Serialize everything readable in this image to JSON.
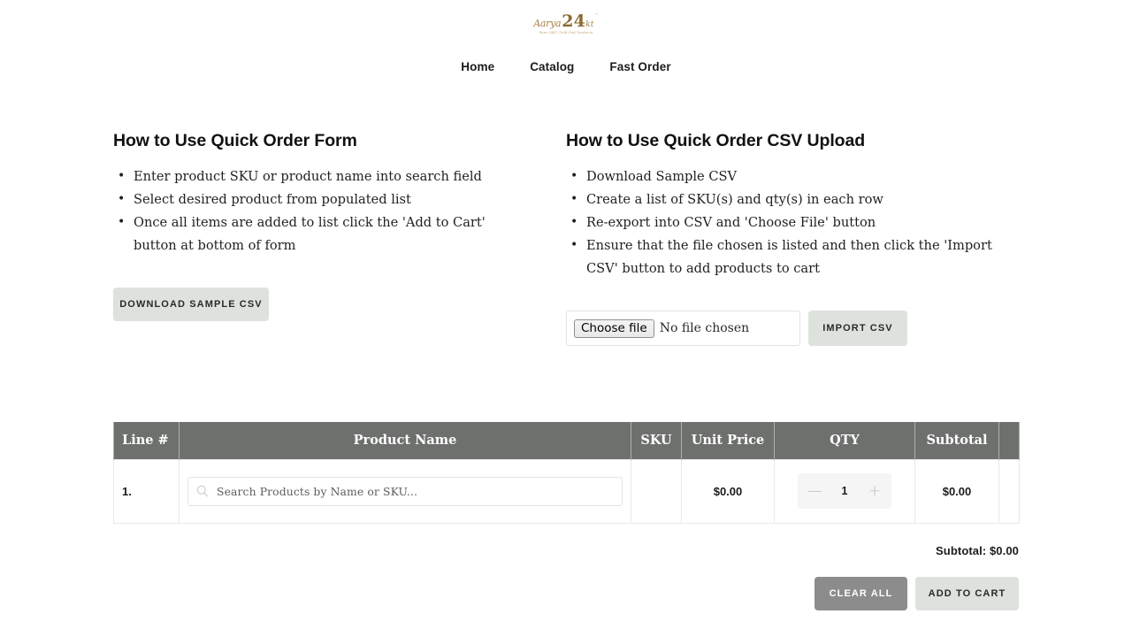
{
  "header": {
    "logo": {
      "word1": "Aarya",
      "word2": "24",
      "word3": "kt",
      "trademark": "™",
      "tagline": "Pure 24KT Gold Foil Products"
    },
    "nav": [
      {
        "label": "Home",
        "name": "nav-home"
      },
      {
        "label": "Catalog",
        "name": "nav-catalog"
      },
      {
        "label": "Fast Order",
        "name": "nav-fast-order"
      }
    ]
  },
  "left_panel": {
    "title": "How to Use Quick Order Form",
    "bullets": [
      "Enter product SKU or product name into search field",
      "Select desired product from populated list",
      "Once all items are added to list click the 'Add to Cart' button at bottom of form"
    ],
    "download_button": "DOWNLOAD SAMPLE CSV"
  },
  "right_panel": {
    "title": "How to Use Quick Order CSV Upload",
    "bullets": [
      "Download Sample CSV",
      "Create a list of SKU(s) and qty(s) in each row",
      "Re-export into CSV and 'Choose File' button",
      "Ensure that the file chosen is listed and then click the 'Import CSV' button to add products to cart"
    ],
    "file_input": {
      "button_label": "Choose file",
      "status": "No file chosen"
    },
    "import_button": "IMPORT CSV"
  },
  "table": {
    "headers": {
      "line": "Line #",
      "product": "Product Name",
      "sku": "SKU",
      "price": "Unit Price",
      "qty": "QTY",
      "subtotal": "Subtotal",
      "remove": ""
    },
    "rows": [
      {
        "line": "1.",
        "search_placeholder": "Search Products by Name or SKU...",
        "sku": "",
        "unit_price": "$0.00",
        "qty": "1",
        "qty_minus": "—",
        "qty_plus": "+",
        "subtotal": "$0.00",
        "remove": ""
      }
    ]
  },
  "footer": {
    "subtotal_label": "Subtotal: $0.00",
    "clear_button": "CLEAR ALL",
    "addcart_button": "ADD TO CART"
  },
  "colors": {
    "header_grey": "#6e706e",
    "sage_button": "#dde2dc",
    "grey_button": "#8c8c8c",
    "logo_gold": "#b08d4f"
  }
}
